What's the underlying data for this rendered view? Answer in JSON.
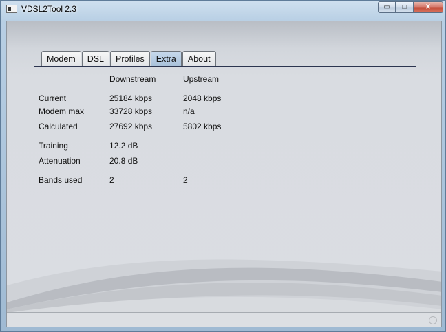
{
  "window": {
    "title": "VDSL2Tool 2.3",
    "buttons": {
      "minimize": "▭",
      "maximize": "□",
      "close": "✕"
    }
  },
  "tabs": [
    {
      "label": "Modem",
      "active": false
    },
    {
      "label": "DSL",
      "active": false
    },
    {
      "label": "Profiles",
      "active": false
    },
    {
      "label": "Extra",
      "active": true
    },
    {
      "label": "About",
      "active": false
    }
  ],
  "table": {
    "headers": {
      "downstream": "Downstream",
      "upstream": "Upstream"
    },
    "rows": [
      {
        "label": "Current",
        "down": "25184 kbps",
        "up": "2048 kbps"
      },
      {
        "label": "Modem max",
        "down": "33728 kbps",
        "up": "n/a"
      },
      {
        "label": "Calculated",
        "down": "27692 kbps",
        "up": "5802 kbps"
      },
      {
        "label": "Training",
        "down": "12.2 dB",
        "up": ""
      },
      {
        "label": "Attenuation",
        "down": "20.8 dB",
        "up": ""
      },
      {
        "label": "Bands used",
        "down": "2",
        "up": "2"
      }
    ]
  },
  "colors": {
    "active_tab": "#a9c1da",
    "rule": "#2c3550"
  }
}
